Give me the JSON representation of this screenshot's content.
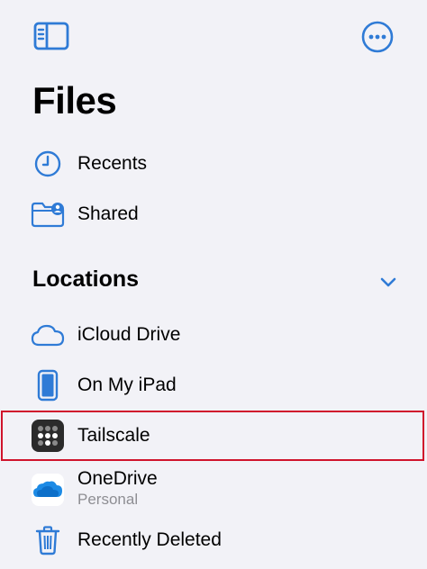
{
  "header": {
    "title": "Files"
  },
  "primary_items": [
    {
      "label": "Recents",
      "icon": "clock-icon"
    },
    {
      "label": "Shared",
      "icon": "shared-folder-icon"
    }
  ],
  "locations": {
    "title": "Locations",
    "items": [
      {
        "label": "iCloud Drive",
        "icon": "cloud-icon"
      },
      {
        "label": "On My iPad",
        "icon": "ipad-icon"
      },
      {
        "label": "Tailscale",
        "icon": "tailscale-icon",
        "highlighted": true
      },
      {
        "label": "OneDrive",
        "sublabel": "Personal",
        "icon": "onedrive-icon"
      },
      {
        "label": "Recently Deleted",
        "icon": "trash-icon"
      }
    ]
  },
  "colors": {
    "accent": "#2f7bd6",
    "background": "#f2f2f7",
    "highlight_border": "#d0142c"
  }
}
